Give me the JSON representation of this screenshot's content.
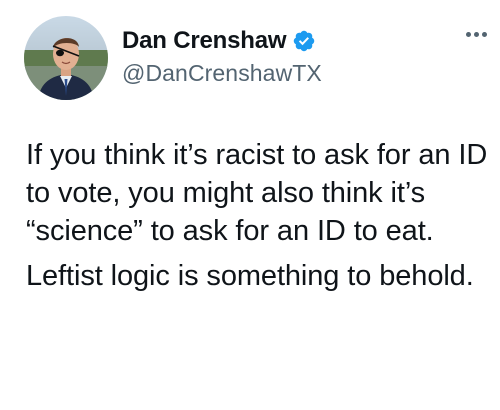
{
  "author": {
    "display_name": "Dan Crenshaw",
    "handle": "@DanCrenshawTX",
    "verified": true,
    "verified_color": "#1d9bf0"
  },
  "tweet": {
    "paragraphs": [
      "If you think it’s racist to ask for an ID to vote, you might also think it’s “science” to ask for an ID to eat.",
      "Leftist logic is something to behold."
    ]
  },
  "icons": {
    "verified": "verified-badge-icon",
    "more": "more-options-icon"
  }
}
